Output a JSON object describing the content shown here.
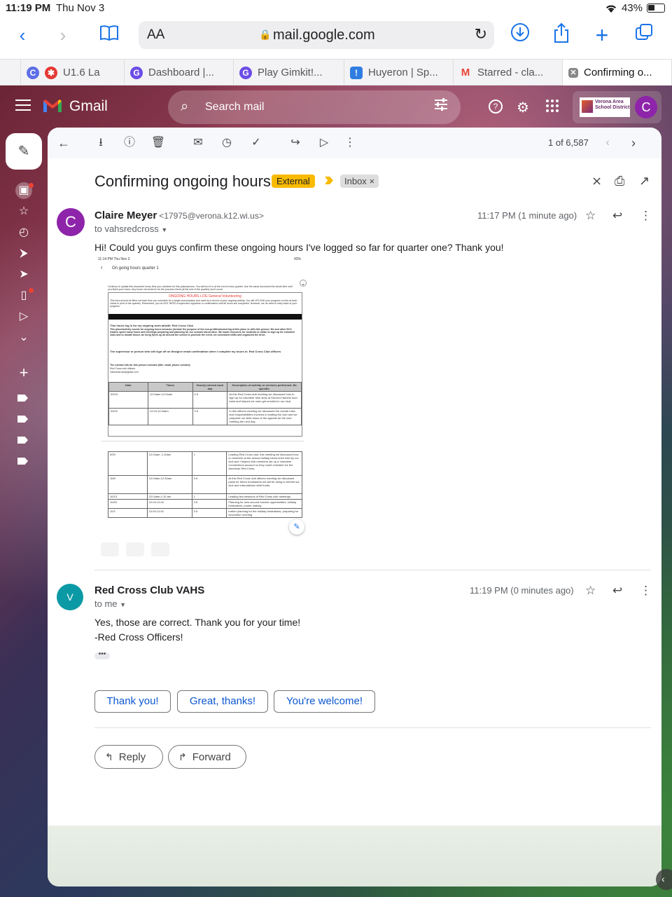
{
  "status": {
    "time": "11:19 PM",
    "date": "Thu Nov 3",
    "battery": "43%"
  },
  "browser": {
    "text_size_label": "AA",
    "url": "mail.google.com",
    "tabs": [
      {
        "label": "U1.6 La",
        "icon": "canvas-icon"
      },
      {
        "label": "Dashboard |...",
        "icon": "gimkit-icon"
      },
      {
        "label": "Play Gimkit!...",
        "icon": "gimkit-icon"
      },
      {
        "label": "Huyeron | Sp...",
        "icon": "app-icon"
      },
      {
        "label": "Starred - cla...",
        "icon": "gmail-icon"
      },
      {
        "label": "Confirming o...",
        "icon": "close-icon"
      }
    ]
  },
  "gmail": {
    "brand": "Gmail",
    "search_placeholder": "Search mail",
    "district_logo": "Verona Area School District",
    "account_initial": "C",
    "counter": "1 of 6,587",
    "subject": "Confirming ongoing hours",
    "labels": {
      "external": "External",
      "inbox": "Inbox"
    }
  },
  "messages": [
    {
      "initial": "C",
      "color": "#8e24aa",
      "sender": "Claire Meyer",
      "address": "<17975@verona.k12.wi.us>",
      "to": "to vahsredcross",
      "time": "11:17 PM (1 minute ago)",
      "body": "Hi! Could you guys confirm these ongoing hours I've logged so far for quarter one? Thank you!"
    },
    {
      "initial": "V",
      "color": "#0b9aa5",
      "sender": "Red Cross Club VAHS",
      "to": "to me",
      "time": "11:19 PM (0 minutes ago)",
      "body_line1": "Yes, those are correct. Thank you for your time!",
      "body_line2": "-Red Cross Officers!"
    }
  ],
  "attachment": {
    "status_time": "11:14 PM  Thu Nov 3",
    "status_battery": "43%",
    "doc_title": "On going hours quarter 1",
    "intro": "Continue to update this document every time you volunteer for this place/person. You will turn it in at the end of every quarter. Use the same document the whole time until you finish your hours. Any hours not turned in for the process check (at the end of the quarter) won't count.",
    "form_title": "ONGOING HOURS LOG General Volunteering",
    "form_text": "This form should be filled out each time you volunteer for a single person/place and used as a record of your ongoing activity. You will UPLOAD your progress on this at each check-in (end of the quarter). Remember, you do NOT NEED a supervisor signature or confirmation until all hours are completed. However, we do need to keep track of your progress.",
    "log_for": "This hours log is for my ongoing work at/with: Red Cross Club",
    "counts_text": "This place/activity counts for ongoing hours because (include the purpose of the non-profit/volunteering at this place or with this person: Me and other RCC leaders spent many hours and meetings preparing and planning for our schools blood drive. We made resources for students to utilize to sign up for volunteer slots and to donate blood, we hung flyers up all around the school to promote the event, we scheduled shifts and organized the drive.",
    "supervisor": "The supervisor or person who will sign off on this/give email confirmation when I complete my hours is: Red Cross Club officers",
    "contact_label": "The contact info for this person includes (title, email, phone number):",
    "contact_1": "Red Cross club officers",
    "contact_2": "Vahsredcross@gmail.com",
    "headers": [
      "Date",
      "Times",
      "Hour(s) earned each day",
      "Description of activity or services performed. Be specific."
    ],
    "rows": [
      [
        "09/15",
        "12:04am-12:34am",
        "0.5",
        "At this Red Cross club meeting we discussed how to sign up for volunteer time slots at Second Harvest food bank and helped me ones get enrolled in our club."
      ],
      [
        "09/22",
        "12:04-12:34am",
        "0.5",
        "In this officers meeting we discussed the overall roles and responsibilities involved in leading the club and we prepared our slide show of the agenda for the club meeting the next day."
      ]
    ],
    "rows2": [
      [
        "9/29",
        "12:04am- 1:10am",
        "1",
        "Leading Red Cross club, this meeting we discussed how to volunteer at the annual holiday blood drive held by our club and I helped club members set up a Volunteer Connections account so they could volunteer for the American Red Cross."
      ],
      [
        "10/6",
        "12:04am-12:34am",
        "0.5",
        "At this Red Cross club officers meeting we discussed plans for future fundraisers we will be doing to benefit our club and international relief funds."
      ],
      [
        "10/13",
        "12:04am-1:10 am",
        "1",
        "Leading two sessions of Red Cross club meetings"
      ],
      [
        "10/20",
        "12:04-12:41",
        "0.5",
        "Planning for new second harvest opportunities, holiday fundraisers, poster making"
      ],
      [
        "11/3",
        "12:04-12:41",
        "0.5",
        "further planning for the holiday fundraisers, preparing for November meeting"
      ]
    ]
  },
  "smart_replies": [
    "Thank you!",
    "Great, thanks!",
    "You're welcome!"
  ],
  "actions": {
    "reply": "Reply",
    "forward": "Forward"
  }
}
